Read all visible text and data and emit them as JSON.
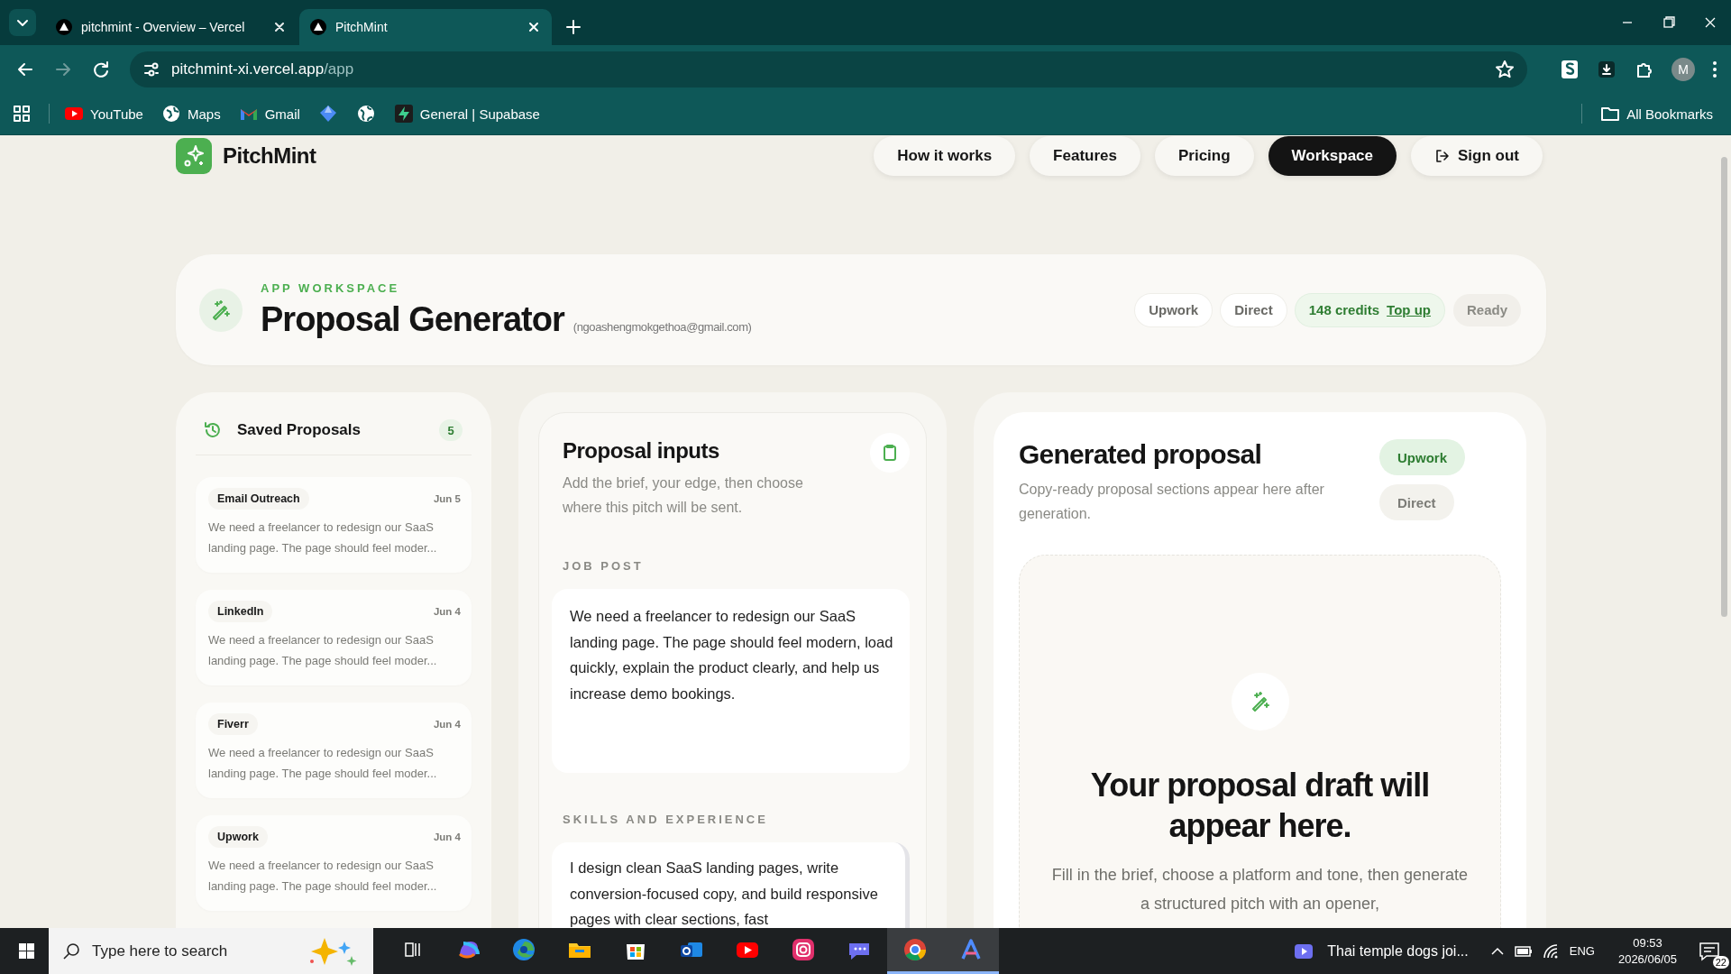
{
  "browser": {
    "tabs": [
      {
        "title": "pitchmint - Overview – Vercel",
        "selected": false
      },
      {
        "title": "PitchMint",
        "selected": true
      }
    ],
    "url": {
      "host": "pitchmint-xi.vercel.app",
      "path": "/app"
    },
    "profile_initial": "M",
    "bookmarks": [
      {
        "kind": "youtube",
        "label": "YouTube"
      },
      {
        "kind": "maps",
        "label": "Maps"
      },
      {
        "kind": "gmail",
        "label": "Gmail"
      },
      {
        "kind": "diamond"
      },
      {
        "kind": "globe"
      },
      {
        "kind": "supabase",
        "label": "General | Supabase"
      }
    ],
    "all_bookmarks": "All Bookmarks"
  },
  "site": {
    "brand": "PitchMint",
    "nav": [
      {
        "label": "How it works",
        "kind": "link",
        "selected": false
      },
      {
        "label": "Features",
        "kind": "link",
        "selected": false
      },
      {
        "label": "Pricing",
        "kind": "link",
        "selected": false
      },
      {
        "label": "Workspace",
        "kind": "link",
        "selected": true
      },
      {
        "label": "Sign out",
        "kind": "signout",
        "selected": false
      }
    ]
  },
  "workspace": {
    "eyebrow": "APP WORKSPACE",
    "title": "Proposal Generator",
    "email": "(ngoashengmokgethoa@gmail.com)",
    "badges": [
      {
        "kind": "plain",
        "label": "Upwork"
      },
      {
        "kind": "plain",
        "label": "Direct"
      },
      {
        "kind": "credits",
        "label": "148 credits",
        "link": "Top up"
      },
      {
        "kind": "status",
        "label": "Ready"
      }
    ]
  },
  "saved": {
    "title": "Saved Proposals",
    "count": "5",
    "items": [
      {
        "tag": "Email Outreach",
        "date": "Jun 5",
        "snippet": "We need a freelancer to redesign our SaaS landing page. The page should feel moder..."
      },
      {
        "tag": "LinkedIn",
        "date": "Jun 4",
        "snippet": "We need a freelancer to redesign our SaaS landing page. The page should feel moder..."
      },
      {
        "tag": "Fiverr",
        "date": "Jun 4",
        "snippet": "We need a freelancer to redesign our SaaS landing page. The page should feel moder..."
      },
      {
        "tag": "Upwork",
        "date": "Jun 4",
        "snippet": "We need a freelancer to redesign our SaaS landing page. The page should feel moder..."
      }
    ]
  },
  "inputs": {
    "title": "Proposal inputs",
    "subtitle": "Add the brief, your edge, then choose where this pitch will be sent.",
    "fields": [
      {
        "label": "JOB POST",
        "value": "We need a freelancer to redesign our SaaS landing page. The page should feel modern, load quickly, explain the product clearly, and help us increase demo bookings."
      },
      {
        "label": "SKILLS AND EXPERIENCE",
        "value": "I design clean SaaS landing pages, write conversion-focused copy, and build responsive pages with clear sections, fast"
      }
    ]
  },
  "output": {
    "title": "Generated proposal",
    "subtitle": "Copy-ready proposal sections appear here after generation.",
    "platforms": [
      {
        "label": "Upwork",
        "selected": true
      },
      {
        "label": "Direct",
        "selected": false
      }
    ],
    "empty": {
      "heading": "Your proposal draft will appear here.",
      "body": "Fill in the brief, choose a platform and tone, then generate a structured pitch with an opener,"
    }
  },
  "taskbar": {
    "search_placeholder": "Type here to search",
    "apps": [
      {
        "kind": "taskview",
        "active": false
      },
      {
        "kind": "m365",
        "active": false
      },
      {
        "kind": "edge",
        "active": false
      },
      {
        "kind": "explorer",
        "active": false
      },
      {
        "kind": "store",
        "active": false
      },
      {
        "kind": "outlook",
        "active": false
      },
      {
        "kind": "youtube",
        "active": false
      },
      {
        "kind": "instagram",
        "active": false
      },
      {
        "kind": "chat",
        "active": false
      },
      {
        "kind": "chrome",
        "active": true
      },
      {
        "kind": "arc",
        "active": true
      }
    ],
    "media": "Thai temple dogs joi...",
    "language": "ENG",
    "time": "09:53",
    "date": "2026/06/05",
    "notifications": "22"
  }
}
